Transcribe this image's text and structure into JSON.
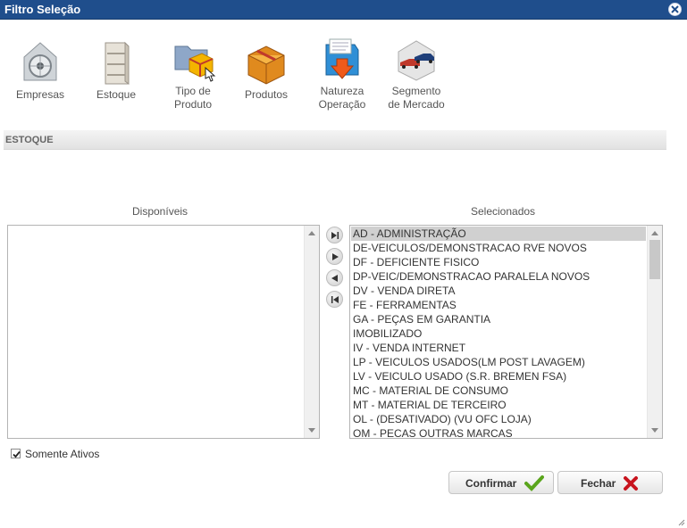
{
  "window": {
    "title": "Filtro Seleção"
  },
  "toolbar": {
    "items": [
      {
        "label_line1": "Empresas",
        "label_line2": "",
        "icon": "lock-vault-icon"
      },
      {
        "label_line1": "Estoque",
        "label_line2": "",
        "icon": "shelf-cabinet-icon"
      },
      {
        "label_line1": "Tipo de",
        "label_line2": "Produto",
        "icon": "folder-box-icon"
      },
      {
        "label_line1": "Produtos",
        "label_line2": "",
        "icon": "package-box-icon"
      },
      {
        "label_line1": "Natureza",
        "label_line2": "Operação",
        "icon": "document-download-icon"
      },
      {
        "label_line1": "Segmento",
        "label_line2": "de Mercado",
        "icon": "cars-segment-icon"
      }
    ]
  },
  "section": {
    "title": "ESTOQUE"
  },
  "lists": {
    "available_label": "Disponíveis",
    "selected_label": "Selecionados",
    "available_items": [],
    "selected_items": [
      "AD - ADMINISTRAÇÃO",
      "DE-VEICULOS/DEMONSTRACAO RVE NOVOS",
      "DF - DEFICIENTE FISICO",
      "DP-VEIC/DEMONSTRACAO PARALELA NOVOS",
      "DV - VENDA DIRETA",
      "FE - FERRAMENTAS",
      "GA - PEÇAS EM GARANTIA",
      "IMOBILIZADO",
      "IV - VENDA INTERNET",
      "LP - VEICULOS USADOS(LM POST LAVAGEM)",
      "LV - VEICULO USADO (S.R. BREMEN FSA)",
      "MC - MATERIAL DE CONSUMO",
      "MT - MATERIAL DE TERCEIRO",
      "OL - (DESATIVADO) (VU OFC LOJA)",
      "OM - PECAS OUTRAS MARCAS"
    ],
    "selected_highlight_index": 0
  },
  "options": {
    "only_active_label": "Somente Ativos",
    "only_active_checked": true
  },
  "buttons": {
    "confirm_label": "Confirmar",
    "close_label": "Fechar"
  },
  "colors": {
    "titlebar": "#1f4e8c",
    "confirm_check": "#5aa51c",
    "close_x": "#c8141e"
  }
}
